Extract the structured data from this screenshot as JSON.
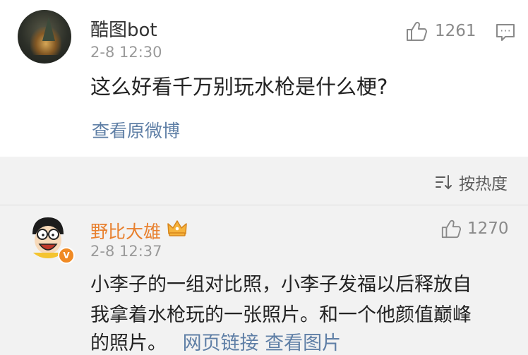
{
  "post": {
    "username": "酷图bot",
    "time": "2-8 12:30",
    "likes": "1261",
    "text": "这么好看千万别玩水枪是什么梗?",
    "view_original": "查看原微博"
  },
  "sort": {
    "label": "按热度",
    "icon": "sort-icon"
  },
  "comment": {
    "username": "野比大雄",
    "time": "2-8 12:37",
    "likes": "1270",
    "lines": [
      "小李子的一组对比照，小李子发福以后释放自",
      "我拿着水枪玩的一张照片。和一个他颜值巅峰",
      "的照片。"
    ],
    "link": "网页链接 查看图片"
  },
  "colors": {
    "username_vip": "#e8802e",
    "link": "#5f7fa6",
    "background": "#f2f2f2"
  }
}
